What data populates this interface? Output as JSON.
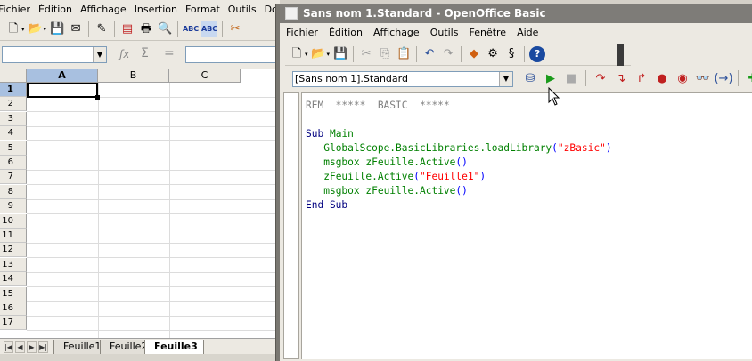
{
  "calc": {
    "menu": [
      "Fichier",
      "Édition",
      "Affichage",
      "Insertion",
      "Format",
      "Outils",
      "Donn"
    ],
    "toolbar_icons": [
      "new-icon",
      "open-icon",
      "save-icon",
      "mail-icon",
      "edit-icon",
      "pdf-icon",
      "print-icon",
      "preview-icon",
      "spellcheck-icon",
      "autospell-icon",
      "cut-icon"
    ],
    "formula": {
      "fx": "ƒx",
      "sigma": "Σ",
      "equals": "="
    },
    "columns": [
      "A",
      "B",
      "C"
    ],
    "selected_column": "A",
    "rows": [
      "1",
      "2",
      "3",
      "4",
      "5",
      "6",
      "7",
      "8",
      "9",
      "10",
      "11",
      "12",
      "13",
      "14",
      "15",
      "16",
      "17"
    ],
    "selected_row": "1",
    "sheets": [
      "Feuille1",
      "Feuille2",
      "Feuille3"
    ],
    "active_sheet": "Feuille3"
  },
  "ide": {
    "title": "Sans nom 1.Standard - OpenOffice Basic",
    "menu": [
      "Fichier",
      "Édition",
      "Affichage",
      "Outils",
      "Fenêtre",
      "Aide"
    ],
    "library": "[Sans nom 1].Standard",
    "code": {
      "l1": "REM  *****  BASIC  *****",
      "l3_kw": "Sub",
      "l3_id": "Main",
      "l4_id": "GlobalScope.BasicLibraries.loadLibrary",
      "l4_open": "(",
      "l4_str": "\"zBasic\"",
      "l4_close": ")",
      "l5_id": "msgbox zFeuille.Active",
      "l5_paren": "()",
      "l6_id": "zFeuille.Active",
      "l6_open": "(",
      "l6_str": "\"Feuille1\"",
      "l6_close": ")",
      "l7_id": "msgbox zFeuille.Active",
      "l7_paren": "()",
      "l8_kw": "End Sub"
    }
  },
  "colors": {
    "title_bar": "#7e7c78",
    "selected_header": "#a8c0e0",
    "keyword": "#000080",
    "identifier": "#008000",
    "string": "#ff0000",
    "comment": "#808080"
  }
}
